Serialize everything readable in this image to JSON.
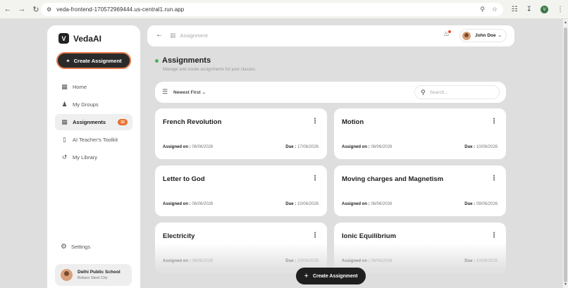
{
  "browser": {
    "url": "veda-frontend-170572969444.us-central1.run.app",
    "profile_initial": "V"
  },
  "sidebar": {
    "brand": "VedaAI",
    "brand_initial": "V",
    "create_label": "Create Assignment",
    "items": [
      {
        "label": "Home",
        "icon": "grid-icon"
      },
      {
        "label": "My Groups",
        "icon": "users-icon"
      },
      {
        "label": "Assignments",
        "icon": "document-icon",
        "badge": "32",
        "active": true
      },
      {
        "label": "AI Teacher's Toolkit",
        "icon": "phone-icon"
      },
      {
        "label": "My Library",
        "icon": "history-icon"
      }
    ],
    "settings_label": "Settings",
    "school": {
      "name": "Delhi Public School",
      "city": "Bokaro Steel City"
    }
  },
  "topbar": {
    "breadcrumb": "Assignment",
    "user_name": "John Doe"
  },
  "header": {
    "title": "Assignments",
    "subtitle": "Manage and create assignments for your classes."
  },
  "filter": {
    "sort_label": "Newest First",
    "search_placeholder": "Search..."
  },
  "labels": {
    "assigned_on": "Assigned on :",
    "due": "Due :"
  },
  "cards": [
    {
      "title": "French Revolution",
      "assigned": "06/06/2026",
      "due": "17/06/2026"
    },
    {
      "title": "Motion",
      "assigned": "06/06/2026",
      "due": "10/06/2026"
    },
    {
      "title": "Letter to God",
      "assigned": "06/06/2026",
      "due": "10/06/2026"
    },
    {
      "title": "Moving charges and Magnetism",
      "assigned": "06/06/2026",
      "due": "09/06/2026"
    },
    {
      "title": "Electricity",
      "assigned": "06/06/2026",
      "due": "10/06/2026"
    },
    {
      "title": "Ionic Equilibrium",
      "assigned": "06/06/2026",
      "due": "10/06/2026"
    }
  ],
  "floating_button": {
    "label": "Create Assignment"
  },
  "colors": {
    "accent": "#e8702e",
    "dark": "#1f1f1f",
    "status_dot": "#4cae5f"
  }
}
